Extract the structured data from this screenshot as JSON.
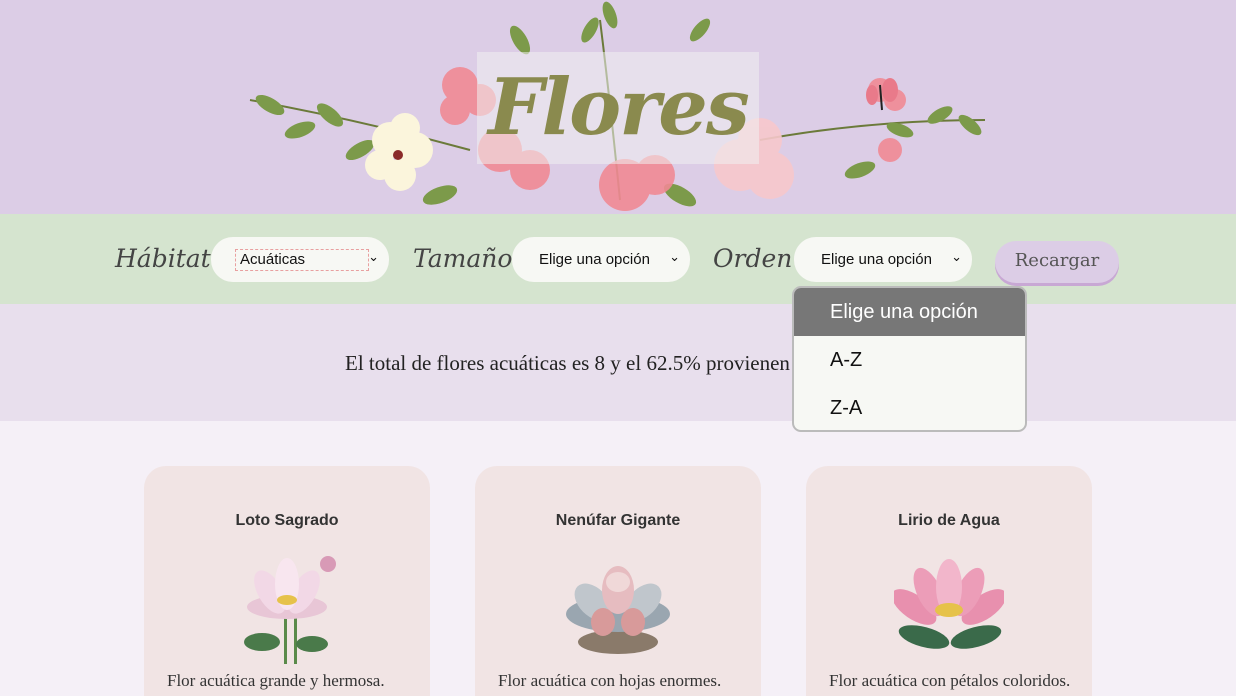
{
  "header": {
    "title": "Flores"
  },
  "filters": {
    "habitat_label": "Hábitat",
    "habitat_value": "Acuáticas",
    "size_label": "Tamaño",
    "size_value": "Elige una opción",
    "order_label": "Orden",
    "order_value": "Elige una opción",
    "reload_label": "Recargar"
  },
  "order_dropdown": {
    "options": [
      "Elige una opción",
      "A-Z",
      "Z-A"
    ],
    "highlighted": "Elige una opción"
  },
  "summary": {
    "text": "El total de flores acuáticas es 8 y el 62.5% provienen"
  },
  "cards": [
    {
      "name": "Loto Sagrado",
      "description": "Flor acuática grande y hermosa."
    },
    {
      "name": "Nenúfar Gigante",
      "description": "Flor acuática con hojas enormes."
    },
    {
      "name": "Lirio de Agua",
      "description": "Flor acuática con pétalos coloridos."
    }
  ],
  "icons": [
    "chevron-down-icon",
    "flower-banner-illustration",
    "lotus-image",
    "water-lily-image",
    "pink-lily-image"
  ]
}
